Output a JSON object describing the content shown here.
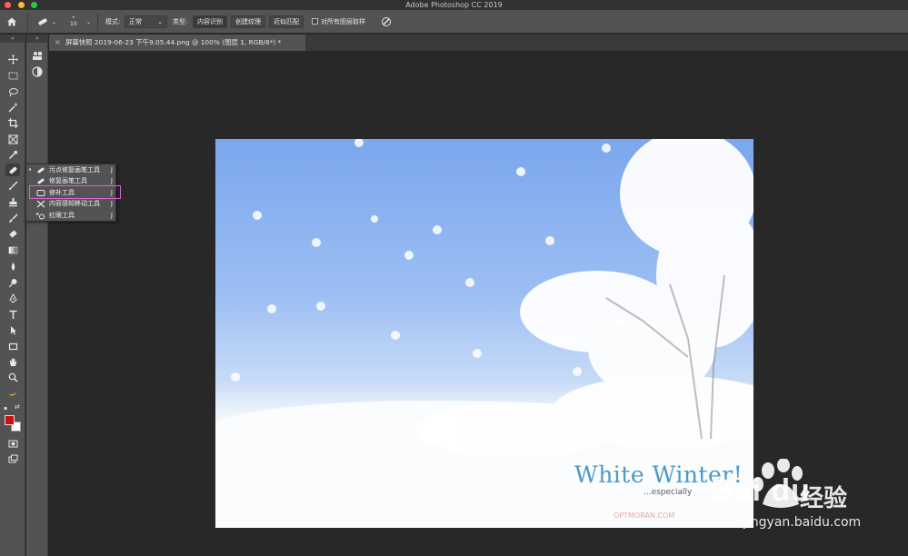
{
  "window": {
    "title": "Adobe Photoshop CC 2019"
  },
  "options_bar": {
    "brush_size": "10",
    "mode_label": "模式:",
    "mode_value": "正常",
    "type_label": "类型:",
    "type_buttons": [
      "内容识别",
      "创建纹理",
      "近似匹配"
    ],
    "sample_all_layers": "对所有图层取样"
  },
  "toolbar": {
    "tools": [
      "move-icon",
      "marquee-icon",
      "lasso-icon",
      "magic-wand-icon",
      "crop-icon",
      "frame-icon",
      "eyedropper-icon",
      "spot-healing-icon",
      "brush-icon",
      "stamp-icon",
      "history-brush-icon",
      "eraser-icon",
      "gradient-icon",
      "blur-icon",
      "dodge-icon",
      "pen-icon",
      "type-icon",
      "path-select-icon",
      "rectangle-icon",
      "hand-icon",
      "zoom-icon",
      "banana-icon"
    ],
    "foreground_color": "#cc1010",
    "background_color": "#ffffff"
  },
  "document": {
    "tab_title": "屏幕快照 2019-06-23 下午9.05.44.png @ 100% (图层 1, RGB/8*) *"
  },
  "flyout": {
    "items": [
      {
        "label": "污点修复画笔工具",
        "shortcut": "J",
        "selected": true
      },
      {
        "label": "修复画笔工具",
        "shortcut": "J",
        "selected": false
      },
      {
        "label": "修补工具",
        "shortcut": "J",
        "selected": false
      },
      {
        "label": "内容感知移动工具",
        "shortcut": "J",
        "selected": false
      },
      {
        "label": "红眼工具",
        "shortcut": "J",
        "selected": false
      }
    ]
  },
  "image": {
    "title": "White Winter!",
    "subtitle": "...especially",
    "brand": "OPTMORAN.COM"
  },
  "watermark": {
    "logo": "Bai du",
    "cn": "经验",
    "url": "jingyan.baidu.com"
  }
}
